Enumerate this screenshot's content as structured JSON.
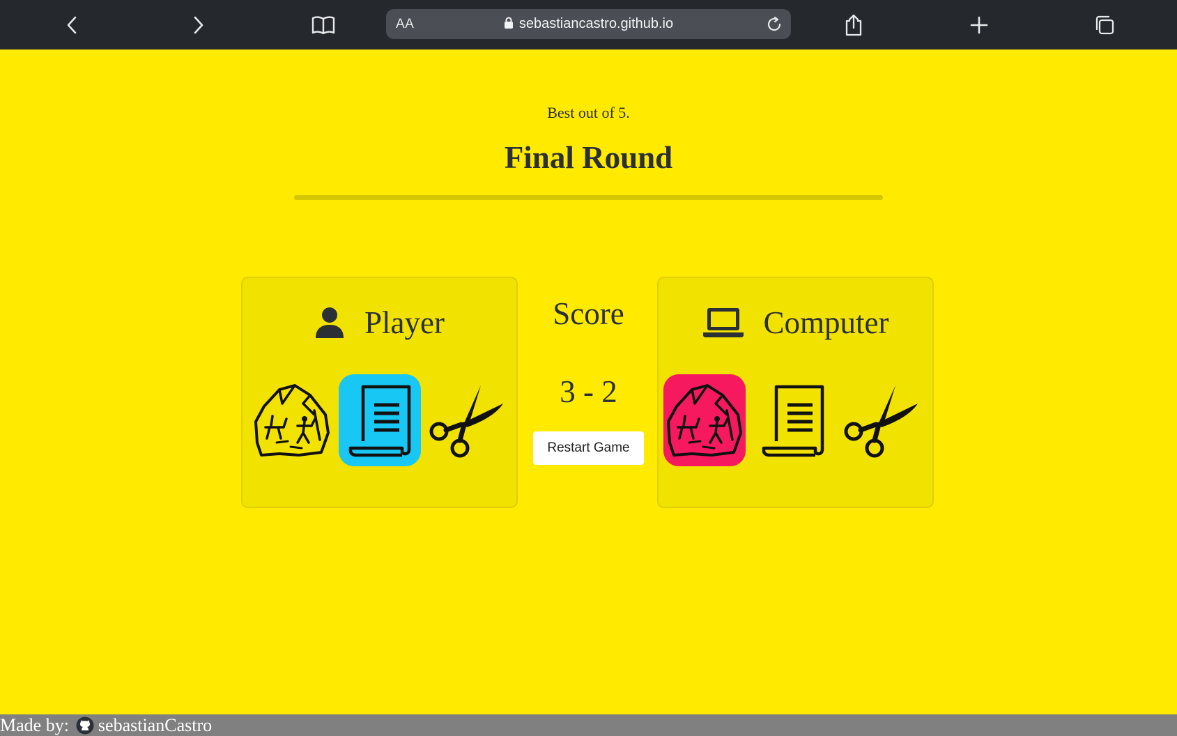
{
  "browser": {
    "text_size_label": "AA",
    "url": "sebastiancastro.github.io"
  },
  "header": {
    "subtitle": "Best out of 5.",
    "title": "Final Round"
  },
  "player": {
    "label": "Player",
    "icon": "user-icon",
    "choices": [
      "rock",
      "paper",
      "scissors"
    ],
    "selected": "paper",
    "selected_color": "#18c7f3"
  },
  "computer": {
    "label": "Computer",
    "icon": "laptop-icon",
    "choices": [
      "rock",
      "paper",
      "scissors"
    ],
    "selected": "rock",
    "selected_color": "#f7195f"
  },
  "score": {
    "label": "Score",
    "value": "3 - 2",
    "restart_label": "Restart Game"
  },
  "footer": {
    "made_by": "Made by:",
    "author": "sebastianCastro",
    "icon": "github-icon"
  },
  "colors": {
    "background": "#ffea00",
    "panel": "#f2e200",
    "toolbar": "#25282d"
  }
}
